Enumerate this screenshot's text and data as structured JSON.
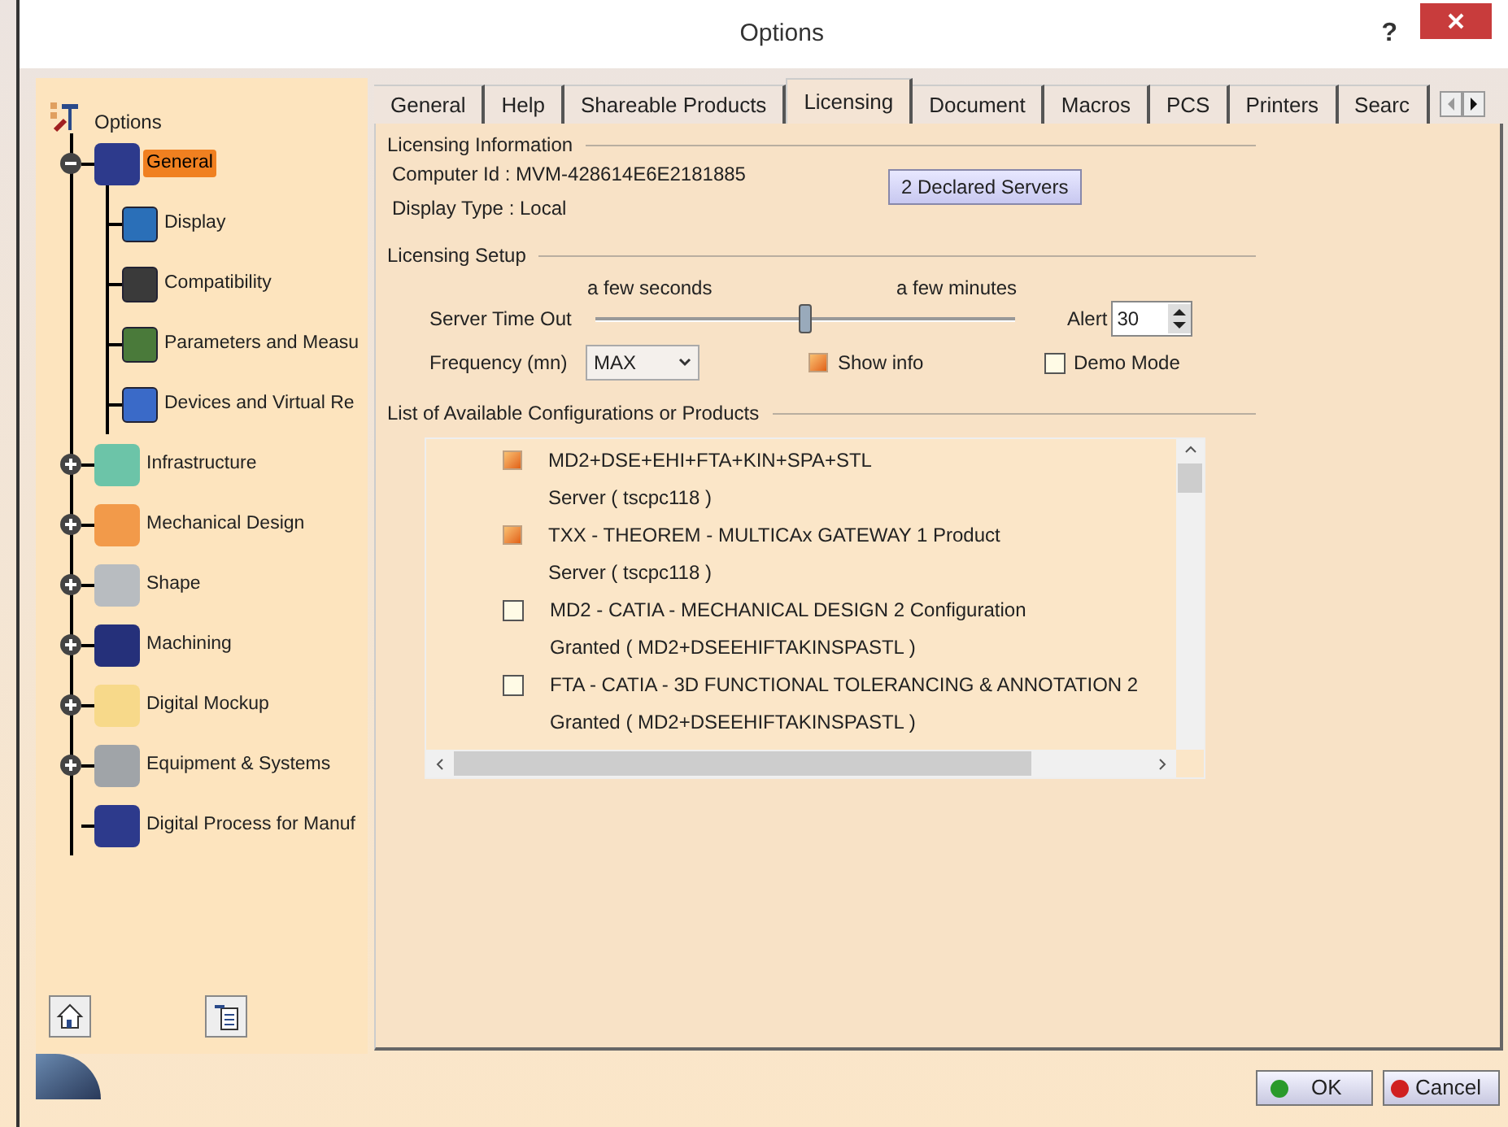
{
  "window": {
    "title": "Options",
    "help": "?"
  },
  "tree": {
    "label": "Options",
    "children": [
      {
        "label": "General",
        "selected": true,
        "expanded": true,
        "children": [
          {
            "label": "Display",
            "selected": false
          },
          {
            "label": "Compatibility",
            "selected": false
          },
          {
            "label": "Parameters and Measu",
            "selected": false
          },
          {
            "label": "Devices and Virtual Re",
            "selected": false
          }
        ]
      },
      {
        "label": "Infrastructure",
        "selected": false,
        "expanded": false
      },
      {
        "label": "Mechanical Design",
        "selected": false,
        "expanded": false
      },
      {
        "label": "Shape",
        "selected": false,
        "expanded": false
      },
      {
        "label": "Machining",
        "selected": false,
        "expanded": false
      },
      {
        "label": "Digital Mockup",
        "selected": false,
        "expanded": false
      },
      {
        "label": "Equipment & Systems",
        "selected": false,
        "expanded": false
      },
      {
        "label": "Digital Process for Manuf",
        "selected": false
      }
    ]
  },
  "tabs": [
    {
      "label": "General",
      "selected": false
    },
    {
      "label": "Help",
      "selected": false
    },
    {
      "label": "Shareable Products",
      "selected": false
    },
    {
      "label": "Licensing",
      "selected": true
    },
    {
      "label": "Document",
      "selected": false
    },
    {
      "label": "Macros",
      "selected": false
    },
    {
      "label": "PCS",
      "selected": false
    },
    {
      "label": "Printers",
      "selected": false
    },
    {
      "label": "Searc",
      "selected": false
    }
  ],
  "licensing_information": {
    "title": "Licensing Information",
    "computer_id": "Computer Id : MVM-428614E6E2181885",
    "display_type": "Display Type : Local",
    "servers_button": "2 Declared Servers"
  },
  "licensing_setup": {
    "title": "Licensing Setup",
    "slider_min_label": "a few seconds",
    "slider_max_label": "a few minutes",
    "server_time_out": {
      "label": "Server Time Out",
      "level": 0.5
    },
    "alert": {
      "label": "Alert",
      "value": "30"
    },
    "frequency": {
      "label": "Frequency (mn)",
      "value": "MAX"
    },
    "show_info": {
      "label": "Show info",
      "checked": true
    },
    "demo_mode": {
      "label": "Demo Mode",
      "checked": false
    }
  },
  "products": {
    "title": "List of Available Configurations or Products",
    "items": [
      {
        "name": "MD2+DSE+EHI+FTA+KIN+SPA+STL",
        "detail": "Server ( tscpc118 )",
        "checked": true
      },
      {
        "name": "TXX - THEOREM - MULTICAx GATEWAY 1 Product",
        "detail": "Server ( tscpc118 )",
        "checked": true
      },
      {
        "name": "MD2 - CATIA - MECHANICAL DESIGN 2 Configuration",
        "detail": "Granted ( MD2+DSEEHIFTAKINSPASTL )",
        "checked": false
      },
      {
        "name": "FTA - CATIA - 3D FUNCTIONAL TOLERANCING & ANNOTATION 2",
        "detail": "Granted ( MD2+DSEEHIFTAKINSPASTL )",
        "checked": false
      }
    ]
  },
  "buttons": {
    "ok": "OK",
    "cancel": "Cancel"
  }
}
